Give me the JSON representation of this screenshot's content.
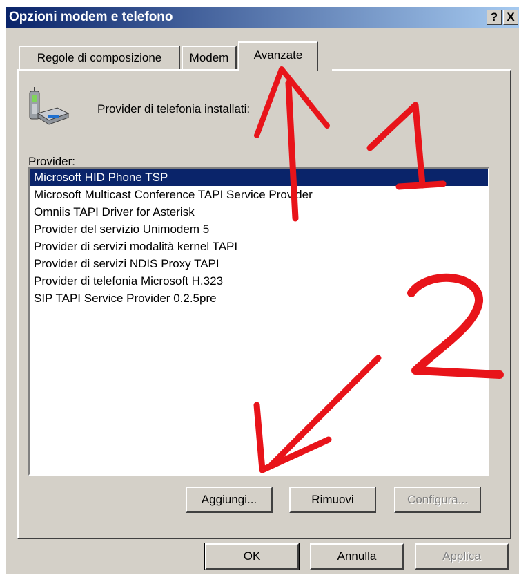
{
  "window": {
    "title": "Opzioni modem e telefono",
    "help_label": "?",
    "close_label": "X"
  },
  "tabs": [
    {
      "label": "Regole di composizione"
    },
    {
      "label": "Modem"
    },
    {
      "label": "Avanzate",
      "active": true
    }
  ],
  "header": {
    "icon": "phone-modem-icon",
    "text": "Provider di telefonia installati:"
  },
  "providers_label": "Provider:",
  "providers": [
    {
      "name": "Microsoft HID Phone TSP",
      "selected": true
    },
    {
      "name": "Microsoft Multicast Conference TAPI Service Provider"
    },
    {
      "name": "Omniis TAPI Driver for Asterisk"
    },
    {
      "name": "Provider del servizio Unimodem 5"
    },
    {
      "name": "Provider di servizi modalità kernel TAPI"
    },
    {
      "name": "Provider di servizi NDIS Proxy TAPI"
    },
    {
      "name": "Provider di telefonia Microsoft H.323"
    },
    {
      "name": "SIP TAPI Service Provider 0.2.5pre"
    }
  ],
  "panel_buttons": {
    "add": "Aggiungi...",
    "remove": "Rimuovi",
    "configure": "Configura..."
  },
  "dialog_buttons": {
    "ok": "OK",
    "cancel": "Annulla",
    "apply": "Applica"
  },
  "annotations": {
    "arrow_1_label": "1",
    "arrow_2_label": "2",
    "color": "#e8141a"
  }
}
